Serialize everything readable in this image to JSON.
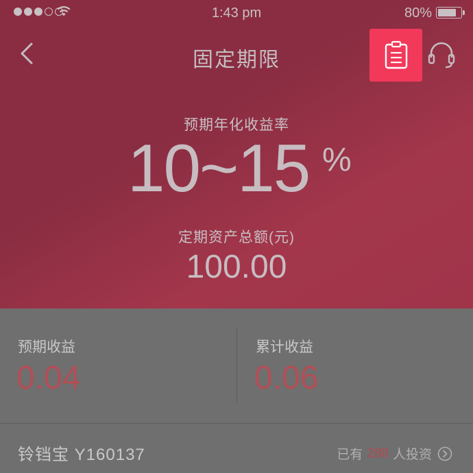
{
  "status_bar": {
    "time": "1:43 pm",
    "battery_text": "80%",
    "battery_level": 0.8,
    "signal_bars": 3,
    "signal_total": 5
  },
  "nav": {
    "title": "固定期限",
    "back_icon": "chevron-left-icon",
    "clipboard_icon": "clipboard-icon",
    "support_icon": "headset-icon"
  },
  "hero": {
    "rate_label": "预期年化收益率",
    "rate_value": "10~15",
    "rate_unit": "%",
    "asset_label": "定期资产总额(元)",
    "asset_value": "100.00"
  },
  "metrics": {
    "expected_label": "预期收益",
    "expected_value": "0.04",
    "cumulative_label": "累计收益",
    "cumulative_value": "0.06"
  },
  "product": {
    "name": "铃铛宝 Y160137",
    "investors_prefix": "已有",
    "investors_count": "288",
    "investors_suffix": "人投资"
  },
  "colors": {
    "hero_bg": "#8a2d42",
    "highlight": "#f2395a",
    "value_red": "#b24e56",
    "overlay_gray": "#6f6f6f"
  }
}
